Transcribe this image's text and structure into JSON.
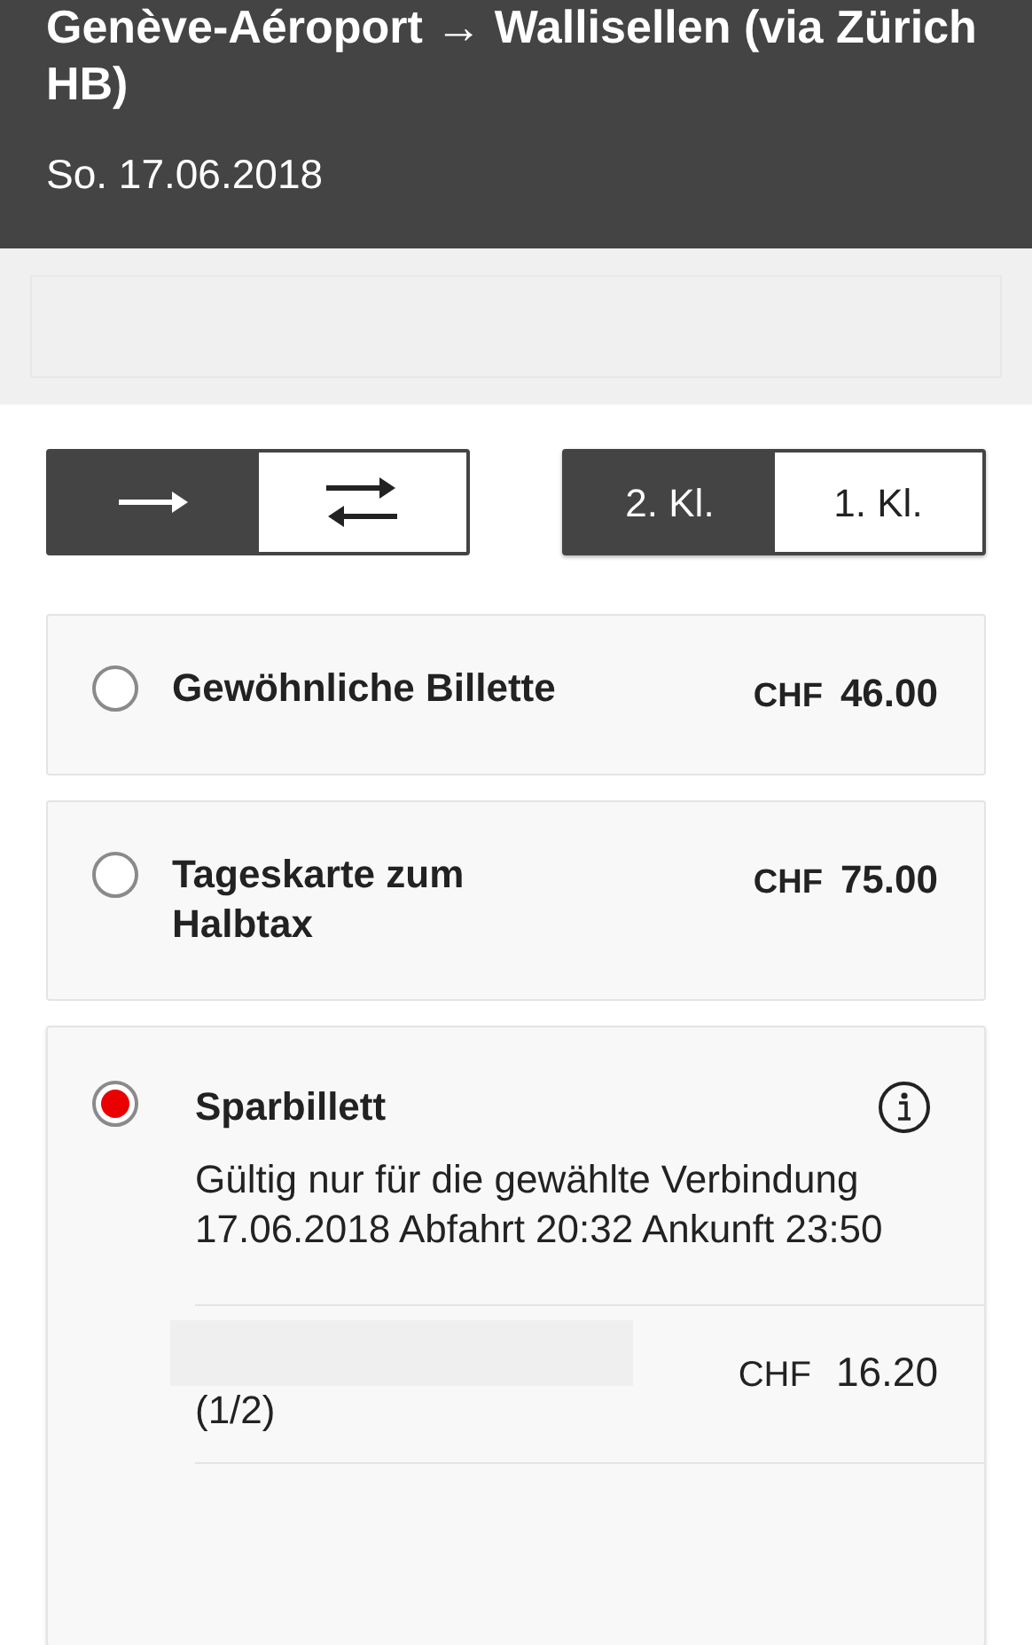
{
  "header": {
    "title": "Genève-Aéroport → Wallisellen (via Zürich HB)",
    "date": "So. 17.06.2018"
  },
  "trip_type": [
    {
      "kind": "one-way",
      "selected": true
    },
    {
      "kind": "return",
      "selected": false
    }
  ],
  "travel_class": [
    {
      "label": "2. Kl.",
      "selected": true
    },
    {
      "label": "1. Kl.",
      "selected": false
    }
  ],
  "offers": [
    {
      "kind": "simple",
      "name": "Gewöhnliche Billette",
      "currency": "CHF",
      "price": "46.00",
      "selected": false
    },
    {
      "kind": "simple",
      "name": "Tageskarte zum Halbtax",
      "currency": "CHF",
      "price": "75.00",
      "selected": false
    },
    {
      "kind": "detailed",
      "name": "Sparbillett",
      "selected": true,
      "description": [
        "Gültig nur für die gewählte Verbindung",
        "17.06.2018 Abfahrt 20:32 Ankunft 23:50"
      ],
      "fare": {
        "note": "(1/2)",
        "currency": "CHF",
        "price": "16.20"
      }
    }
  ]
}
